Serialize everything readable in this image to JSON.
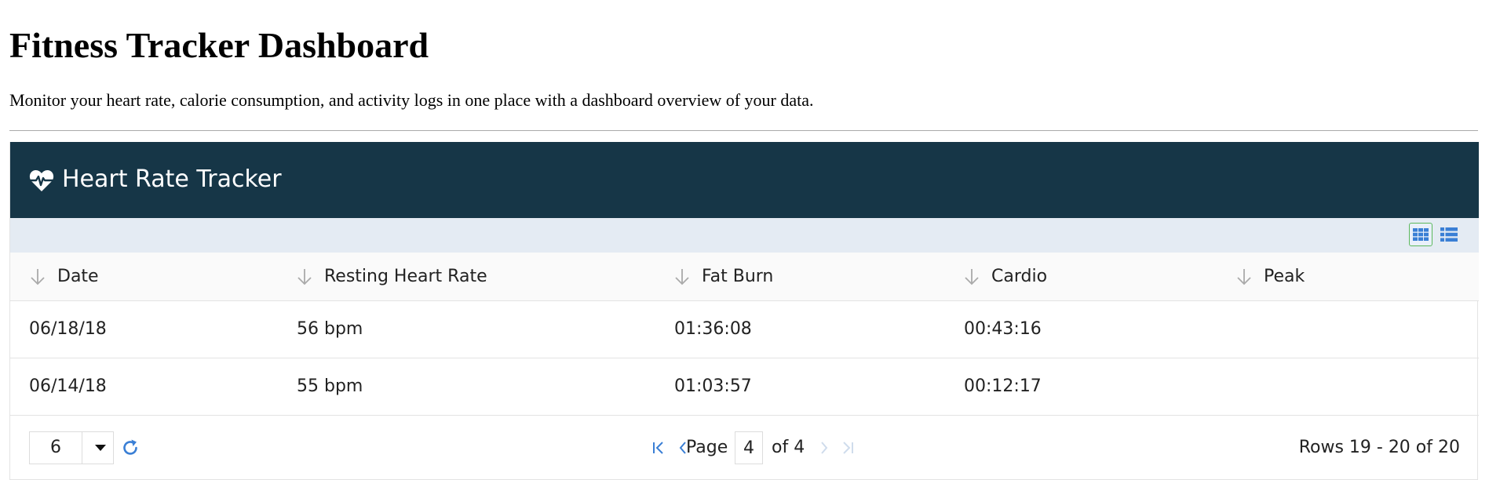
{
  "page": {
    "title": "Fitness Tracker Dashboard",
    "description": "Monitor your heart rate, calorie consumption, and activity logs in one place with a dashboard overview of your data."
  },
  "widget": {
    "title": "Heart Rate Tracker",
    "header_color": "#163647",
    "toolbar_color": "#e4ebf3",
    "accent_color": "#3a7fd5",
    "icon": "heart-pulse-icon",
    "view_icons": [
      "grid-view-icon",
      "list-view-icon"
    ]
  },
  "table": {
    "columns": [
      {
        "label": "Date",
        "sort_icon": "sort-down-icon"
      },
      {
        "label": "Resting Heart Rate",
        "sort_icon": "sort-down-icon"
      },
      {
        "label": "Fat Burn",
        "sort_icon": "sort-down-icon"
      },
      {
        "label": "Cardio",
        "sort_icon": "sort-down-icon"
      },
      {
        "label": "Peak",
        "sort_icon": "sort-down-icon"
      }
    ],
    "rows": [
      {
        "date": "06/18/18",
        "resting": "56 bpm",
        "fat_burn": "01:36:08",
        "cardio": "00:43:16",
        "peak": ""
      },
      {
        "date": "06/14/18",
        "resting": "55 bpm",
        "fat_burn": "01:03:57",
        "cardio": "00:12:17",
        "peak": ""
      }
    ]
  },
  "pager": {
    "page_size": "6",
    "page_label": "Page",
    "current_page": "4",
    "of_label": "of 4",
    "rows_info": "Rows 19 - 20 of 20"
  }
}
